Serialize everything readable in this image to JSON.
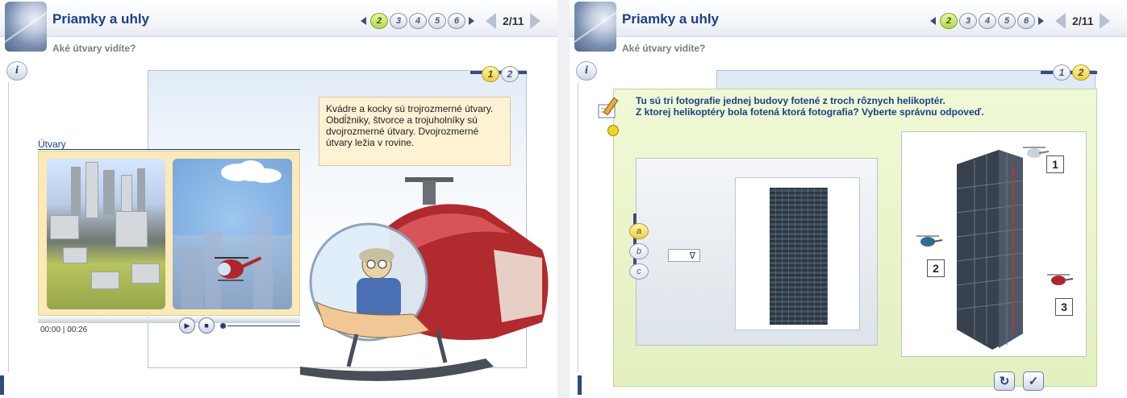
{
  "left": {
    "title": "Priamky a uhly",
    "subtitle": "Aké útvary vidíte?",
    "pages": [
      "2",
      "3",
      "4",
      "5",
      "6"
    ],
    "active_page": "2",
    "counter": "2/11",
    "tabs": [
      "1",
      "2"
    ],
    "active_tab": "1",
    "tooltip": "Kvádre a kocky sú trojrozmerné útvary. Obdĺžniky, štvorce a trojuholníky sú dvojrozmerné útvary. Dvojrozmerné útvary ležia v rovine.",
    "video_label": "Útvary",
    "time_current": "00:00",
    "time_total": "00:26",
    "info_icon": "i"
  },
  "right": {
    "title": "Priamky a uhly",
    "subtitle": "Aké útvary vidíte?",
    "pages": [
      "2",
      "3",
      "4",
      "5",
      "6"
    ],
    "active_page": "2",
    "counter": "2/11",
    "tabs": [
      "1",
      "2"
    ],
    "active_tab": "2",
    "question_line1": "Tu sú tri fotografie jednej budovy fotené z troch rôznych helikoptér.",
    "question_line2": "Z ktorej helikoptéry bola fotená ktorá fotografia? Vyberte správnu odpoveď.",
    "options": [
      "a",
      "b",
      "c"
    ],
    "active_option": "a",
    "select_value": "",
    "select_arrow": "∇",
    "heli_numbers": [
      "1",
      "2",
      "3"
    ],
    "info_icon": "i"
  },
  "icons": {
    "play": "▶",
    "stop": "■",
    "replay": "↻",
    "check": "✓"
  },
  "colors": {
    "title": "#1b3f8a",
    "active_page": "#b7d64b",
    "active_tab": "#eccf45",
    "tooltip_bg": "#fdf2d4",
    "question_bg": "#e9f4cc"
  }
}
